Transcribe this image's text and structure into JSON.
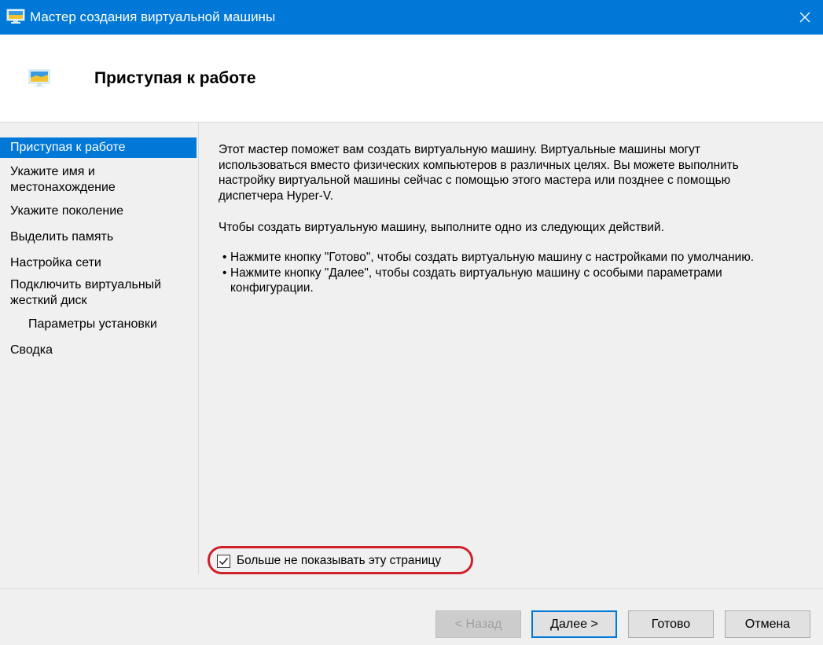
{
  "window": {
    "title": "Мастер создания виртуальной машины",
    "app_icon": "monitor-icon",
    "close_icon": "close-icon"
  },
  "header": {
    "icon": "monitor-icon",
    "title": "Приступая к работе"
  },
  "sidebar": {
    "items": [
      {
        "label": "Приступая к работе",
        "active": true
      },
      {
        "label": "Укажите имя и местонахождение",
        "active": false
      },
      {
        "label": "Укажите поколение",
        "active": false
      },
      {
        "label": "Выделить память",
        "active": false
      },
      {
        "label": "Настройка сети",
        "active": false
      },
      {
        "label": "Подключить виртуальный жесткий диск",
        "active": false
      },
      {
        "label": "Параметры установки",
        "active": false
      },
      {
        "label": "Сводка",
        "active": false
      }
    ]
  },
  "content": {
    "intro_lines": [
      "Этот мастер поможет вам создать виртуальную машину. Виртуальные машины могут",
      "использоваться вместо физических компьютеров в различных целях. Вы можете выполнить",
      "настройку виртуальной машины сейчас с помощью этого мастера или позднее с помощью",
      "диспетчера Hyper-V."
    ],
    "instruction": "Чтобы создать виртуальную машину, выполните одно из следующих действий.",
    "bullet1": "Нажмите кнопку \"Готово\", чтобы создать виртуальную машину с настройками по умолчанию.",
    "bullet2_line1": "Нажмите кнопку \"Далее\", чтобы создать виртуальную машину с особыми параметрами",
    "bullet2_line2": "конфигурации.",
    "bullet_char": "•"
  },
  "checkbox": {
    "label": "Больше не показывать эту страницу",
    "checked": true
  },
  "buttons": {
    "back": "< Назад",
    "next": "Далее >",
    "finish": "Готово",
    "cancel": "Отмена"
  },
  "colors": {
    "accent": "#0078d7",
    "highlight_ring": "#d0202a"
  }
}
